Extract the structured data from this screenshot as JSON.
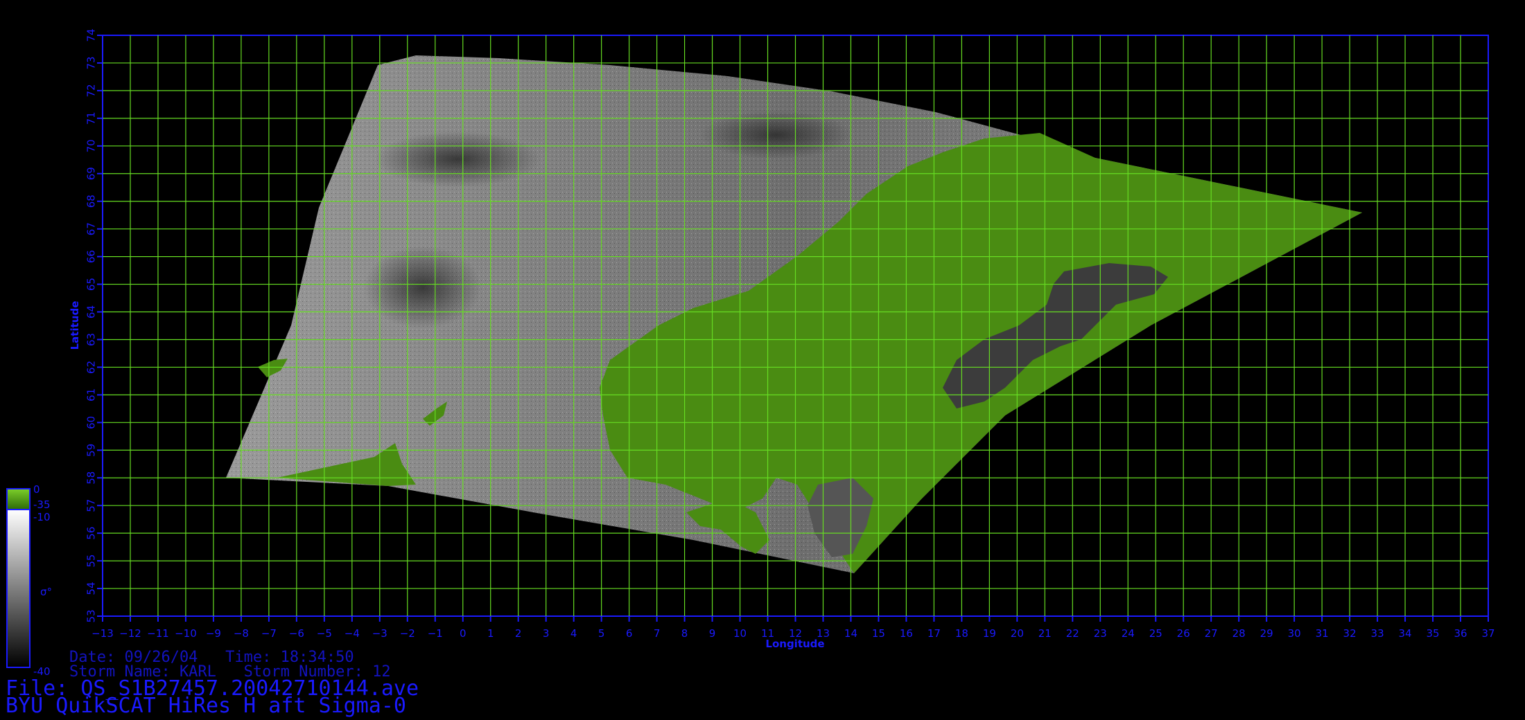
{
  "colors": {
    "grid": "#66dd22",
    "axis": "#1a1aff",
    "land": "#4a8c12",
    "background": "#000000"
  },
  "map": {
    "xlabel": "Longitude",
    "ylabel": "Latitude",
    "lon_range": [
      -13,
      37
    ],
    "lat_range": [
      53,
      74
    ],
    "grid": true
  },
  "colorbar": {
    "symbol": "σ°",
    "tick_labels": [
      "0",
      "-35",
      "-10",
      "-40"
    ],
    "land_range": [
      0,
      -35
    ],
    "sigma_range": [
      -10,
      -40
    ]
  },
  "info": {
    "date_time": "Date: 09/26/04   Time: 18:34:50",
    "storm": "Storm Name: KARL   Storm Number: 12",
    "file": "File: QS_S1B27457.20042710144.ave",
    "product": "BYU QuikSCAT HiRes H aft Sigma-0"
  }
}
